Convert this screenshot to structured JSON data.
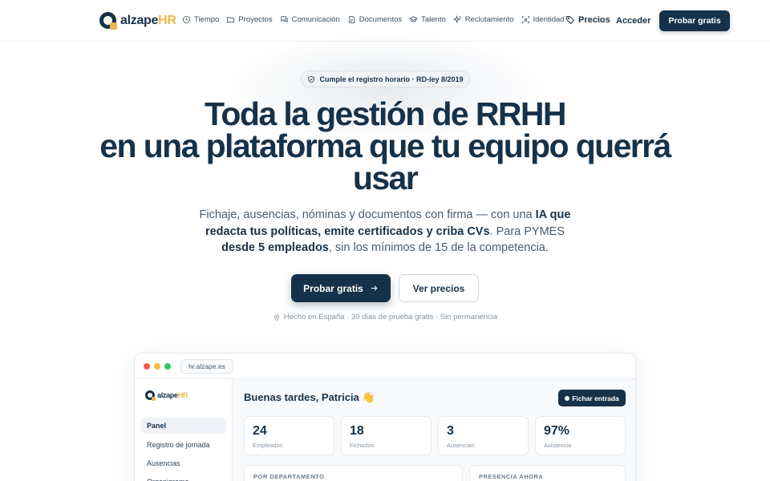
{
  "nav": {
    "logo": {
      "name": "alzape",
      "suffix": "HR"
    },
    "items": [
      {
        "label": "Tiempo",
        "icon": "clock-icon"
      },
      {
        "label": "Proyectos",
        "icon": "folder-icon"
      },
      {
        "label": "Comunicación",
        "icon": "chat-icon"
      },
      {
        "label": "Documentos",
        "icon": "document-icon"
      },
      {
        "label": "Talento",
        "icon": "graduation-cap-icon"
      },
      {
        "label": "Reclutamiento",
        "icon": "sparkles-icon"
      },
      {
        "label": "Identidad",
        "icon": "scan-face-icon"
      }
    ],
    "pricing": "Precios",
    "login": "Acceder",
    "cta": "Probar gratis"
  },
  "hero": {
    "badge": "Cumple el registro horario · RD-ley 8/2019",
    "headline_line1": "Toda la gestión de RRHH",
    "headline_line2": "en una plataforma que tu equipo querrá",
    "headline_line3": "usar",
    "sub_part1": "Fichaje, ausencias, nóminas y documentos con firma — con una ",
    "sub_bold1": "IA que redacta tus políticas, emite certificados y criba CVs",
    "sub_part2": ". Para PYMES ",
    "sub_bold2": "desde 5 empleados",
    "sub_part3": ", sin los mínimos de 15 de la competencia.",
    "cta_primary": "Probar gratis",
    "cta_secondary": "Ver precios",
    "made_in": "Hecho en España · 30 días de prueba gratis · Sin permanencia"
  },
  "mock": {
    "url": "hr.alzape.es",
    "logo": {
      "name": "alzape",
      "suffix": "HR"
    },
    "sidebar": [
      "Panel",
      "Registro de jornada",
      "Ausencias",
      "Organigrama"
    ],
    "greeting": "Buenas tardes, Patricia 👋",
    "clock_in": "Fichar entrada",
    "stats": [
      {
        "value": "24",
        "label": "Empleados"
      },
      {
        "value": "18",
        "label": "Fichados"
      },
      {
        "value": "3",
        "label": "Ausencias"
      },
      {
        "value": "97%",
        "label": "Asistencia"
      }
    ],
    "panels": [
      "POR DEPARTAMENTO",
      "PRESENCIA AHORA"
    ]
  },
  "colors": {
    "brand": "#16324a",
    "accent": "#e8b84a"
  }
}
